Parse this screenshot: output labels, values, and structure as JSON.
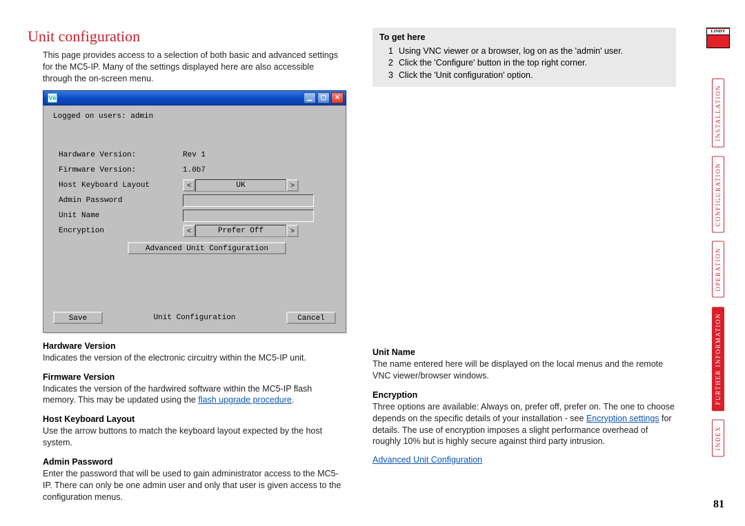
{
  "page_number": "81",
  "brand": "LINDY",
  "section": {
    "title": "Unit configuration",
    "intro": "This page provides access to a selection of both basic and advanced settings for the MC5-IP. Many of the settings displayed here are also accessible through the on-screen menu."
  },
  "to_get_here": {
    "heading": "To get here",
    "steps": [
      "Using VNC viewer or a browser, log on as the 'admin' user.",
      "Click the 'Configure' button in the top right corner.",
      "Click the 'Unit configuration' option."
    ]
  },
  "screenshot": {
    "logged_on": "Logged on users: admin",
    "fields": {
      "hardware_label": "Hardware Version:",
      "hardware_value": "Rev 1",
      "firmware_label": "Firmware Version:",
      "firmware_value": "1.0b7",
      "host_kb_label": "Host Keyboard Layout",
      "host_kb_value": "UK",
      "admin_pw_label": "Admin Password",
      "admin_pw_value": "",
      "unit_name_label": "Unit Name",
      "unit_name_value": "",
      "encryption_label": "Encryption",
      "encryption_value": "Prefer Off"
    },
    "adv_button": "Advanced Unit Configuration",
    "footer_title": "Unit Configuration",
    "save": "Save",
    "cancel": "Cancel",
    "titlebar_icon": "Vē"
  },
  "left_descriptions": {
    "hw_h": "Hardware Version",
    "hw_t": "Indicates the version of the electronic circuitry within the MC5-IP unit.",
    "fw_h": "Firmware Version",
    "fw_t1": "Indicates the version of the hardwired software within the MC5-IP flash memory. This may be updated using the ",
    "fw_link": "flash upgrade procedure",
    "fw_t2": ".",
    "kb_h": "Host Keyboard Layout",
    "kb_t": "Use the arrow buttons to match the keyboard layout expected by the host system.",
    "ap_h": "Admin Password",
    "ap_t": "Enter the password that will be used to gain administrator access to the MC5-IP. There can only be one admin user and only that user is given access to the configuration menus."
  },
  "right_descriptions": {
    "un_h": "Unit Name",
    "un_t": "The name entered here will be displayed on the local menus and the remote VNC viewer/browser windows.",
    "enc_h": "Encryption",
    "enc_t1": "Three options are available: Always on, prefer off, prefer on. The one to choose depends on the specific details of your installation - see ",
    "enc_link": "Encryption settings",
    "enc_t2": " for details. The use of encryption imposes a slight performance overhead of roughly 10% but is highly secure against third party intrusion.",
    "adv_link": "Advanced Unit Configuration"
  },
  "side_nav": {
    "items": [
      "INSTALLATION",
      "CONFIGURATION",
      "OPERATION",
      "FURTHER INFORMATION",
      "INDEX"
    ],
    "active_index": 3
  }
}
